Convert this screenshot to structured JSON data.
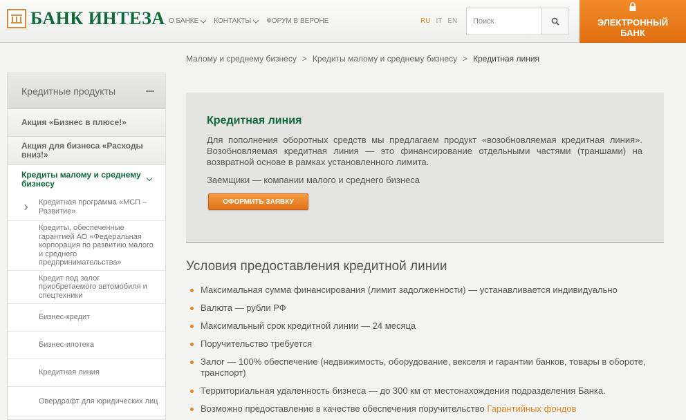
{
  "header": {
    "logo_text": "БАНК ИНТЕЗА",
    "nav": [
      {
        "label": "О БАНКЕ",
        "has_dropdown": true
      },
      {
        "label": "КОНТАКТЫ",
        "has_dropdown": true
      },
      {
        "label": "ФОРУМ В ВЕРОНЕ",
        "has_dropdown": false
      }
    ],
    "langs": [
      "RU",
      "IT",
      "EN"
    ],
    "active_lang": "RU",
    "search_placeholder": "Поиск",
    "ebank_line1": "ЭЛЕКТРОННЫЙ",
    "ebank_line2": "БАНК"
  },
  "breadcrumb": {
    "items": [
      "Малому и среднему бизнесу",
      "Кредиты малому и среднему бизнесу"
    ],
    "separator": ">",
    "current": "Кредитная линия"
  },
  "sidebar": {
    "title": "Кредитные продукты",
    "items": [
      {
        "label": "Акция «Бизнес в плюсе!»"
      },
      {
        "label": "Акция для бизнеса «Расходы вниз!»"
      },
      {
        "label": "Кредиты малому и среднему бизнесу"
      }
    ],
    "sub_items": [
      {
        "label": "Кредитная программа «МСП – Развитие»"
      },
      {
        "label": "Кредиты, обеспеченные гарантией АО «Федеральная корпорация по развитию малого и среднего предпринимательства»"
      },
      {
        "label": "Кредит под залог приобретаемого автомобиля и спецтехники"
      },
      {
        "label": "Бизнес-кредит"
      },
      {
        "label": "Бизнес-ипотека"
      },
      {
        "label": "Кредитная линия"
      },
      {
        "label": "Овердрафт для юридических лиц"
      }
    ]
  },
  "promo": {
    "title": "Кредитная линия",
    "text": "Для пополнения оборотных средств мы предлагаем продукт «возобновляемая кредитная линия». Возобновляемая кредитная линия — это финансирование отдельными частями (траншами) на возвратной основе в рамках установленного лимита.",
    "borrowers": "Заемщики — компании малого и среднего бизнеса",
    "apply_label": "ОФОРМИТЬ ЗАЯВКУ"
  },
  "conditions": {
    "title": "Условия предоставления кредитной линии",
    "items": [
      "Максимальная сумма финансирования (лимит задолженности) — устанавливается индивидуально",
      "Валюта — рубли РФ",
      "Максимальный срок кредитной линии — 24 месяца",
      "Поручительство требуется",
      "Залог — 100% обеспечение (недвижимость, оборудование, векселя и гарантии банков, товары в обороте, транспорт)",
      "Территориальная удаленность бизнеса — до 300 км от местонахождения подразделения Банка."
    ],
    "last_item_text": "Возможно предоставление в качестве обеспечения поручительство",
    "last_item_link": "Гарантийных фондов"
  },
  "colors": {
    "brand_green": "#0e6a3c",
    "accent_orange": "#e8841e"
  }
}
